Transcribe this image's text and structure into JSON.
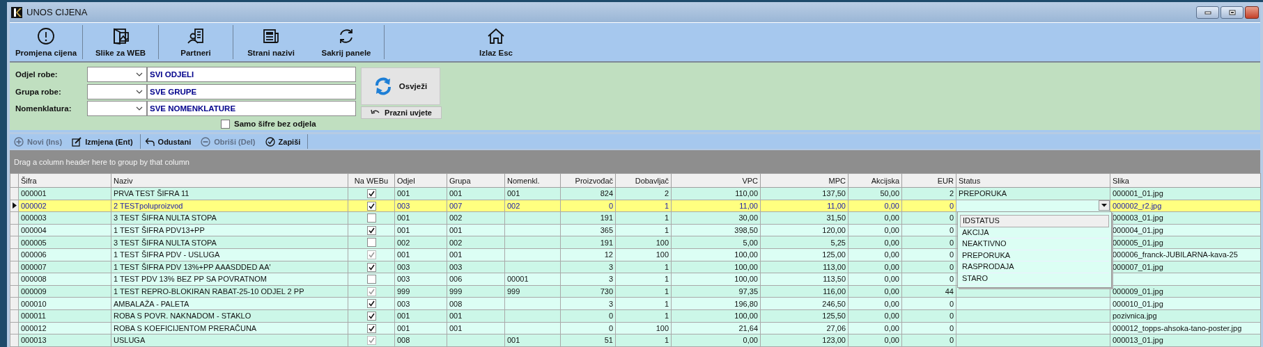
{
  "window": {
    "title": "UNOS CIJENA"
  },
  "toolbar": {
    "groups": [
      [
        {
          "label": "Promjena cijena"
        }
      ],
      [
        {
          "label": "Slike za WEB"
        }
      ],
      [
        {
          "label": "Partneri"
        }
      ],
      [
        {
          "label": "Strani nazivi"
        },
        {
          "label": "Sakrij panele"
        }
      ],
      [
        {
          "label": "Izlaz Esc"
        }
      ]
    ]
  },
  "filters": [
    {
      "label": "Odjel robe:",
      "value": "SVI ODJELI"
    },
    {
      "label": "Grupa robe:",
      "value": "SVE GRUPE"
    },
    {
      "label": "Nomenklatura:",
      "value": "SVE NOMENKLATURE"
    }
  ],
  "refresh_button": "Osvježi",
  "clear_button": "Prazni uvjete",
  "only_without_dept": {
    "label": "Samo šifre bez odjela",
    "checked": false
  },
  "actions": {
    "groups": [
      [
        {
          "label": "Novi (Ins)",
          "disabled": true
        },
        {
          "label": "Izmjena (Ent)",
          "disabled": false
        }
      ],
      [
        {
          "label": "Odustani",
          "disabled": false
        },
        {
          "label": "Obriši (Del)",
          "disabled": true
        },
        {
          "label": "Zapiši",
          "disabled": false
        }
      ]
    ]
  },
  "group_panel": "Drag a column header here to group by that column",
  "table": {
    "columns": [
      {
        "label": "Šifra",
        "kind": "text"
      },
      {
        "label": "Naziv",
        "kind": "text"
      },
      {
        "label": "Na WEBu",
        "kind": "check"
      },
      {
        "label": "Odjel",
        "kind": "text"
      },
      {
        "label": "Grupa",
        "kind": "text"
      },
      {
        "label": "Nomenkl.",
        "kind": "text"
      },
      {
        "label": "Proizvođač",
        "kind": "number"
      },
      {
        "label": "Dobavljač",
        "kind": "number"
      },
      {
        "label": "VPC",
        "kind": "number"
      },
      {
        "label": "MPC",
        "kind": "number"
      },
      {
        "label": "Akcijska",
        "kind": "number"
      },
      {
        "label": "EUR",
        "kind": "number"
      },
      {
        "label": "Status",
        "kind": "status"
      },
      {
        "label": "Slika",
        "kind": "text"
      }
    ],
    "rows": [
      {
        "selected": false,
        "cells": [
          "000001",
          "PRVA TEST ŠIFRA 11",
          {
            "checked": true,
            "disabled": false
          },
          "001",
          "001",
          "001",
          "824",
          "2",
          "110,00",
          "137,50",
          "50,00",
          "2",
          "PREPORUKA",
          "000001_01.jpg"
        ]
      },
      {
        "selected": true,
        "cells": [
          "000002",
          "2 TESTpoluproizvod",
          {
            "checked": true,
            "disabled": false
          },
          "003",
          "007",
          "002",
          "0",
          "1",
          "11,00",
          "11,00",
          "0,00",
          "0",
          null,
          "000002_r2.jpg"
        ]
      },
      {
        "selected": false,
        "cells": [
          "000003",
          "3 TEST ŠIFRA NULTA STOPA",
          {
            "checked": false,
            "disabled": false
          },
          "001",
          "002",
          null,
          "191",
          "1",
          "30,00",
          "31,50",
          "0,00",
          "0",
          null,
          "000003_01.jpg"
        ]
      },
      {
        "selected": false,
        "cells": [
          "000004",
          "1 TEST ŠIFRA  PDV13+PP",
          {
            "checked": true,
            "disabled": false
          },
          "001",
          "001",
          null,
          "365",
          "1",
          "398,50",
          "120,00",
          "0,00",
          "0",
          null,
          "000004_01.jpg"
        ]
      },
      {
        "selected": false,
        "cells": [
          "000005",
          "3 TEST ŠIFRA NULTA STOPA",
          {
            "checked": false,
            "disabled": false
          },
          "002",
          "002",
          null,
          "191",
          "100",
          "5,00",
          "5,25",
          "0,00",
          "0",
          null,
          "000005_01.jpg"
        ]
      },
      {
        "selected": false,
        "cells": [
          "000006",
          "1 TEST ŠIFRA  PDV - USLUGA",
          {
            "checked": true,
            "disabled": true
          },
          "001",
          "001",
          null,
          "12",
          "100",
          "100,00",
          "125,00",
          "0,00",
          "0",
          null,
          "000006_franck-JUBILARNA-kava-25"
        ]
      },
      {
        "selected": false,
        "cells": [
          "000007",
          "1 TEST ŠIFRA  PDV 13%+PP AAASDDED AA'",
          {
            "checked": true,
            "disabled": false
          },
          "003",
          "003",
          null,
          "3",
          "1",
          "100,00",
          "113,00",
          "0,00",
          "0",
          null,
          "000007_01.jpg"
        ]
      },
      {
        "selected": false,
        "cells": [
          "000008",
          "1 TEST  PDV 13% BEZ PP SA POVRATNOM",
          {
            "checked": false,
            "disabled": false
          },
          "003",
          "006",
          "00001",
          "3",
          "1",
          "100,00",
          "113,50",
          "0,00",
          "0",
          null,
          null
        ]
      },
      {
        "selected": false,
        "cells": [
          "000009",
          "1 TEST REPRO-BLOKIRAN RABAT-25-10 ODJEL 2 PP",
          {
            "checked": true,
            "disabled": true
          },
          "999",
          "999",
          "999",
          "730",
          "1",
          "97,35",
          "116,00",
          "0,00",
          "44",
          null,
          "000009_01.jpg"
        ]
      },
      {
        "selected": false,
        "cells": [
          "000010",
          "AMBALAŽA - PALETA",
          {
            "checked": true,
            "disabled": false
          },
          "003",
          "008",
          null,
          "3",
          "1",
          "196,80",
          "246,50",
          "0,00",
          "0",
          null,
          "000010_01.jpg"
        ]
      },
      {
        "selected": false,
        "cells": [
          "000011",
          "ROBA S POVR. NAKNADOM - STAKLO",
          {
            "checked": true,
            "disabled": false
          },
          "001",
          "001",
          null,
          "0",
          "1",
          "100,00",
          "125,50",
          "0,00",
          "0",
          null,
          "pozivnica.jpg"
        ]
      },
      {
        "selected": false,
        "cells": [
          "000012",
          "ROBA S KOEFICIJENTOM PRERAČUNA",
          {
            "checked": true,
            "disabled": false
          },
          "001",
          "001",
          null,
          "0",
          "100",
          "21,64",
          "27,06",
          "0,00",
          "0",
          null,
          "000012_topps-ahsoka-tano-poster.jpg"
        ]
      },
      {
        "selected": false,
        "cells": [
          "000013",
          "USLUGA",
          {
            "checked": true,
            "disabled": true
          },
          "008",
          null,
          "001",
          "51",
          "1",
          "0,00",
          "123,00",
          "0,00",
          "0",
          null,
          "000013_01.jpg"
        ]
      }
    ]
  },
  "status_dropdown": {
    "items": [
      {
        "label": "IDSTATUS",
        "selected": true
      },
      {
        "label": "AKCIJA",
        "selected": false
      },
      {
        "label": "NEAKTIVNO",
        "selected": false
      },
      {
        "label": "PREPORUKA",
        "selected": false
      },
      {
        "label": "RASPRODAJA",
        "selected": false
      },
      {
        "label": "STARO",
        "selected": false
      }
    ]
  }
}
